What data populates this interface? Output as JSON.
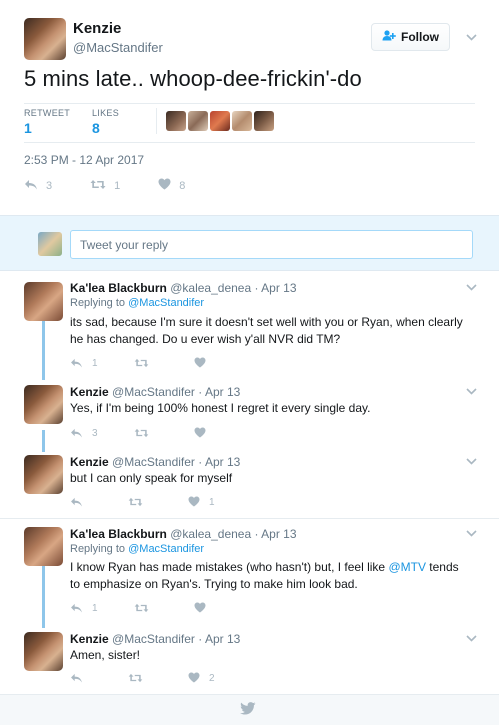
{
  "main_tweet": {
    "author_name": "Kenzie",
    "author_handle": "@MacStandifer",
    "follow_label": "Follow",
    "text": "5 mins late.. whoop-dee-frickin'-do",
    "retweets_label": "RETWEET",
    "retweets_count": "1",
    "likes_label": "LIKES",
    "likes_count": "8",
    "timestamp": "2:53 PM - 12 Apr 2017",
    "reply_count": "3",
    "retweet_action_count": "1",
    "like_action_count": "8",
    "liker_colors": [
      "#6b4a3a",
      "#a98770",
      "#b8432f",
      "#c9a88b",
      "#5a3e2f"
    ]
  },
  "reply_box": {
    "placeholder": "Tweet your reply"
  },
  "replies": [
    {
      "name": "Ka'lea Blackburn",
      "handle": "@kalea_denea",
      "date": "Apr 13",
      "replying_to_prefix": "Replying to",
      "replying_to": "@MacStandifer",
      "text": "its sad, because I'm sure it doesn't set well with you or Ryan, when clearly he has changed. Do u ever wish y'all NVR did TM?",
      "reply_count": "1",
      "retweet_count": "",
      "like_count": ""
    },
    {
      "name": "Kenzie",
      "handle": "@MacStandifer",
      "date": "Apr 13",
      "text": "Yes, if I'm being 100% honest I regret it every single day.",
      "reply_count": "3",
      "retweet_count": "",
      "like_count": ""
    },
    {
      "name": "Kenzie",
      "handle": "@MacStandifer",
      "date": "Apr 13",
      "text": "but I can only speak for myself",
      "reply_count": "",
      "retweet_count": "",
      "like_count": "1"
    },
    {
      "name": "Ka'lea Blackburn",
      "handle": "@kalea_denea",
      "date": "Apr 13",
      "replying_to_prefix": "Replying to",
      "replying_to": "@MacStandifer",
      "text_before": "I know Ryan has made mistakes (who hasn't) but, I feel like ",
      "mention": "@MTV",
      "text_after": " tends to emphasize on Ryan's. Trying to make him look bad.",
      "reply_count": "1",
      "retweet_count": "",
      "like_count": ""
    },
    {
      "name": "Kenzie",
      "handle": "@MacStandifer",
      "date": "Apr 13",
      "text": "Amen, sister!",
      "reply_count": "",
      "retweet_count": "",
      "like_count": "2"
    }
  ],
  "icons": {
    "reply": "↩",
    "retweet": "⇄",
    "like": "♥",
    "caret": "⌄",
    "follow": "👤+",
    "separator_dot": "·",
    "bird": "🐦"
  }
}
